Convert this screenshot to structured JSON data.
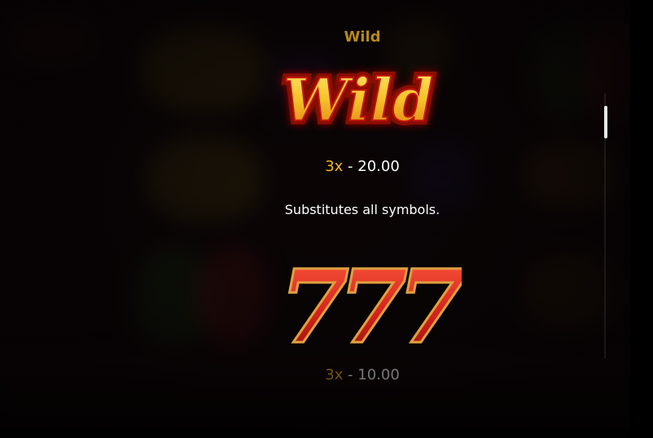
{
  "paytable": {
    "heading": "Wild",
    "symbols": [
      {
        "name": "Wild",
        "logo_text": "Wild",
        "multiplier": "3x",
        "payout": " - 20.00",
        "description": "Substitutes all symbols."
      },
      {
        "name": "777",
        "logo_text": "777",
        "multiplier": "3x",
        "payout": " - 10.00"
      }
    ]
  },
  "colors": {
    "heading": "#b58a18",
    "multiplier": "#f1b81d",
    "wild_gold": "#f5c22a",
    "wild_red": "#c2160c",
    "seven_red": "#d3231b"
  }
}
